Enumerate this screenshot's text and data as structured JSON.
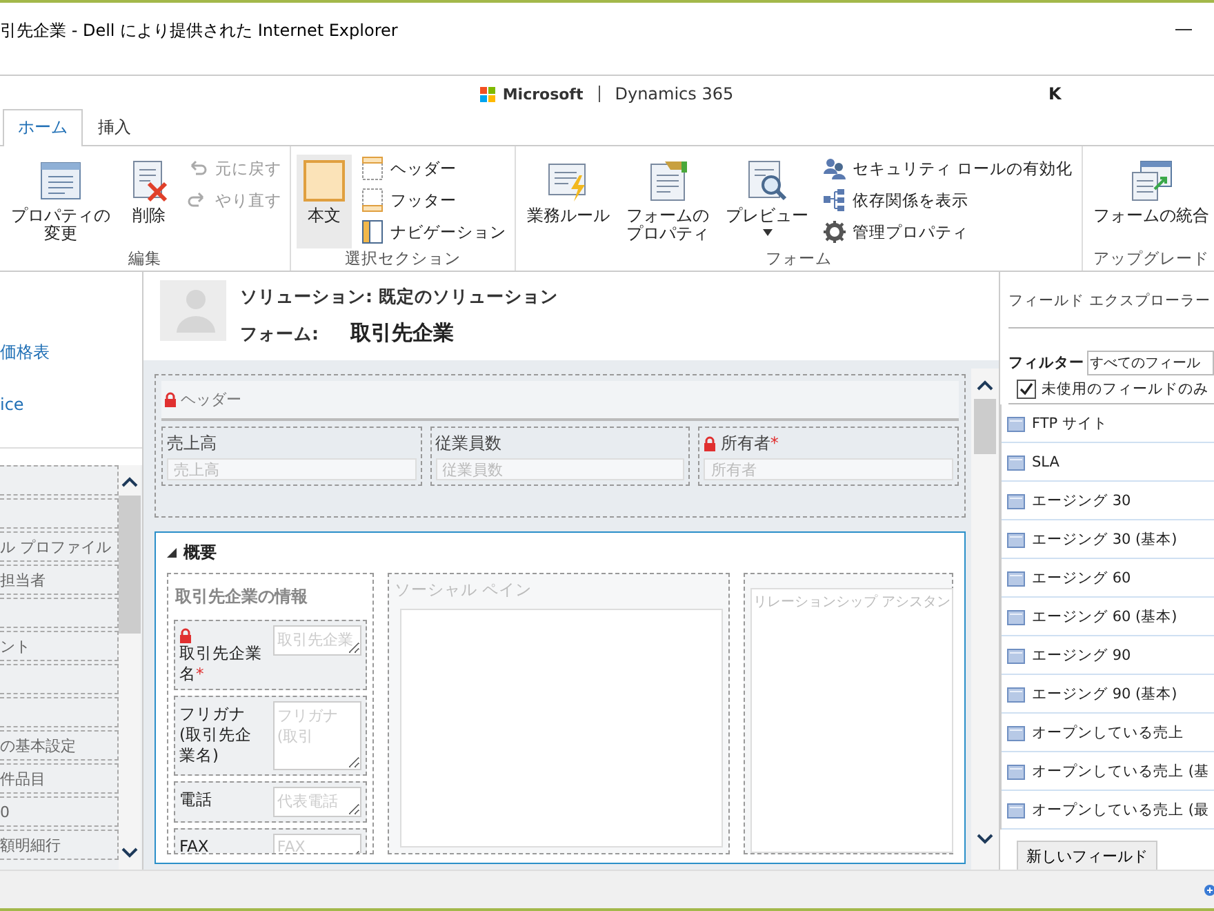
{
  "window": {
    "title": "引先企業 - Dell により提供された Internet Explorer"
  },
  "app_header": {
    "brand": "Microsoft",
    "product": "Dynamics 365",
    "user": "K"
  },
  "tabs": [
    {
      "label": "ホーム",
      "selected": true
    },
    {
      "label": "挿入",
      "selected": false
    }
  ],
  "ribbon": {
    "groups": [
      {
        "label": "編集",
        "buttons": [
          {
            "kind": "large",
            "lines": [
              "プロパティの",
              "変更"
            ],
            "disabled": false,
            "selected": false,
            "has_menu": false
          },
          {
            "kind": "large",
            "lines": [
              "削除"
            ],
            "disabled": false,
            "selected": false,
            "has_menu": false
          },
          {
            "kind": "small",
            "lines": [
              "元に戻す"
            ],
            "disabled": true,
            "selected": false,
            "has_menu": false
          },
          {
            "kind": "small",
            "lines": [
              "やり直す"
            ],
            "disabled": true,
            "selected": false,
            "has_menu": false
          }
        ]
      },
      {
        "label": "選択セクション",
        "buttons": [
          {
            "kind": "large",
            "lines": [
              "本文"
            ],
            "disabled": false,
            "selected": true,
            "has_menu": false
          },
          {
            "kind": "small",
            "lines": [
              "ヘッダー"
            ],
            "disabled": false,
            "selected": false,
            "has_menu": false
          },
          {
            "kind": "small",
            "lines": [
              "フッター"
            ],
            "disabled": false,
            "selected": false,
            "has_menu": false
          },
          {
            "kind": "small",
            "lines": [
              "ナビゲーション"
            ],
            "disabled": false,
            "selected": false,
            "has_menu": false
          }
        ]
      },
      {
        "label": "フォーム",
        "buttons": [
          {
            "kind": "large",
            "lines": [
              "業務ルール"
            ],
            "disabled": false,
            "selected": false,
            "has_menu": false
          },
          {
            "kind": "large",
            "lines": [
              "フォームの",
              "プロパティ"
            ],
            "disabled": false,
            "selected": false,
            "has_menu": false
          },
          {
            "kind": "large",
            "lines": [
              "プレビュー"
            ],
            "disabled": false,
            "selected": false,
            "has_menu": true
          },
          {
            "kind": "small",
            "lines": [
              "セキュリティ ロールの有効化"
            ],
            "disabled": false,
            "selected": false,
            "has_menu": false
          },
          {
            "kind": "small",
            "lines": [
              "依存関係を表示"
            ],
            "disabled": false,
            "selected": false,
            "has_menu": false
          },
          {
            "kind": "small",
            "lines": [
              "管理プロパティ"
            ],
            "disabled": false,
            "selected": false,
            "has_menu": false
          }
        ]
      },
      {
        "label": "アップグレード",
        "buttons": [
          {
            "kind": "large",
            "lines": [
              "フォームの統合"
            ],
            "disabled": false,
            "selected": false,
            "has_menu": false
          }
        ]
      }
    ]
  },
  "left_nav": {
    "links": [
      "価格表",
      "ice"
    ],
    "items": [
      {
        "kind": "empty"
      },
      {
        "kind": "empty"
      },
      {
        "kind": "text",
        "label": "ル プロファイル"
      },
      {
        "kind": "text",
        "label": "担当者"
      },
      {
        "kind": "empty"
      },
      {
        "kind": "text",
        "label": "ント"
      },
      {
        "kind": "empty"
      },
      {
        "kind": "empty"
      },
      {
        "kind": "text",
        "label": "の基本設定"
      },
      {
        "kind": "text",
        "label": "件品目"
      },
      {
        "kind": "text",
        "label": "0"
      },
      {
        "kind": "text",
        "label": "額明細行"
      }
    ]
  },
  "form_header": {
    "solution": "ソリューション: 既定のソリューション",
    "form_label": "フォーム:",
    "form_name": "取引先企業"
  },
  "header_section": {
    "title": "ヘッダー",
    "locked": true,
    "fields": [
      {
        "label": "売上高",
        "placeholder": "売上高",
        "locked": false
      },
      {
        "label": "従業員数",
        "placeholder": "従業員数",
        "locked": false
      },
      {
        "label": "所有者",
        "required_mark": "*",
        "placeholder": "所有者",
        "locked": true
      }
    ]
  },
  "form_tab": {
    "title": "概要",
    "expanded": true,
    "section": {
      "title": "取引先企業の情報",
      "fields": [
        {
          "label": "取引先企業名",
          "required_mark": "*",
          "placeholder": "取引先企業",
          "locked": true
        },
        {
          "label": "フリガナ (取引先企業名)",
          "placeholder": "フリガナ (取引",
          "locked": false
        },
        {
          "label": "電話",
          "placeholder": "代表電話",
          "locked": false
        },
        {
          "label": "FAX",
          "placeholder": "FAX",
          "locked": false
        }
      ]
    },
    "social_pane": "ソーシャル ペイン",
    "relationship_assistant": "リレーションシップ アシスタン"
  },
  "field_explorer": {
    "title": "フィールド エクスプローラー",
    "filter_label": "フィルター",
    "filter_value": "すべてのフィール",
    "unused_only": {
      "label": "未使用のフィールドのみ",
      "checked": true
    },
    "fields": [
      "FTP サイト",
      "SLA",
      "エージング 30",
      "エージング 30 (基本)",
      "エージング 60",
      "エージング 60 (基本)",
      "エージング 90",
      "エージング 90 (基本)",
      "オープンしている売上",
      "オープンしている売上 (基",
      "オープンしている売上 (最"
    ],
    "new_field_button": "新しいフィールド"
  }
}
